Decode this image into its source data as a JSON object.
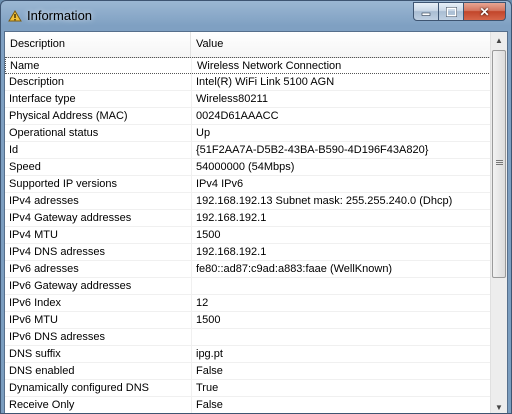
{
  "window": {
    "title": "Information"
  },
  "columns": {
    "description": "Description",
    "value": "Value"
  },
  "rows": [
    {
      "key": "Name",
      "value": "Wireless Network Connection"
    },
    {
      "key": "Description",
      "value": "Intel(R) WiFi Link 5100 AGN"
    },
    {
      "key": "Interface type",
      "value": "Wireless80211"
    },
    {
      "key": "Physical Address (MAC)",
      "value": "0024D61AAACC"
    },
    {
      "key": "Operational status",
      "value": "Up"
    },
    {
      "key": "Id",
      "value": "{51F2AA7A-D5B2-43BA-B590-4D196F43A820}"
    },
    {
      "key": "Speed",
      "value": "54000000 (54Mbps)"
    },
    {
      "key": "Supported IP versions",
      "value": "IPv4 IPv6"
    },
    {
      "key": "IPv4 adresses",
      "value": "192.168.192.13 Subnet mask: 255.255.240.0 (Dhcp)"
    },
    {
      "key": "IPv4 Gateway addresses",
      "value": "192.168.192.1"
    },
    {
      "key": "IPv4 MTU",
      "value": "1500"
    },
    {
      "key": "IPv4 DNS adresses",
      "value": "192.168.192.1"
    },
    {
      "key": "IPv6 adresses",
      "value": "fe80::ad87:c9ad:a883:faae (WellKnown)"
    },
    {
      "key": "IPv6 Gateway addresses",
      "value": ""
    },
    {
      "key": "IPv6 Index",
      "value": "12"
    },
    {
      "key": "IPv6 MTU",
      "value": "1500"
    },
    {
      "key": "IPv6 DNS adresses",
      "value": ""
    },
    {
      "key": "DNS suffix",
      "value": "ipg.pt"
    },
    {
      "key": "DNS enabled",
      "value": "False"
    },
    {
      "key": "Dynamically configured DNS",
      "value": "True"
    },
    {
      "key": "Receive Only",
      "value": "False"
    }
  ],
  "icons": {
    "app": "info-app-icon",
    "minimize": "minimize-icon",
    "maximize": "maximize-icon",
    "close": "close-icon",
    "scroll_up": "arrow-up-icon",
    "scroll_down": "arrow-down-icon"
  }
}
